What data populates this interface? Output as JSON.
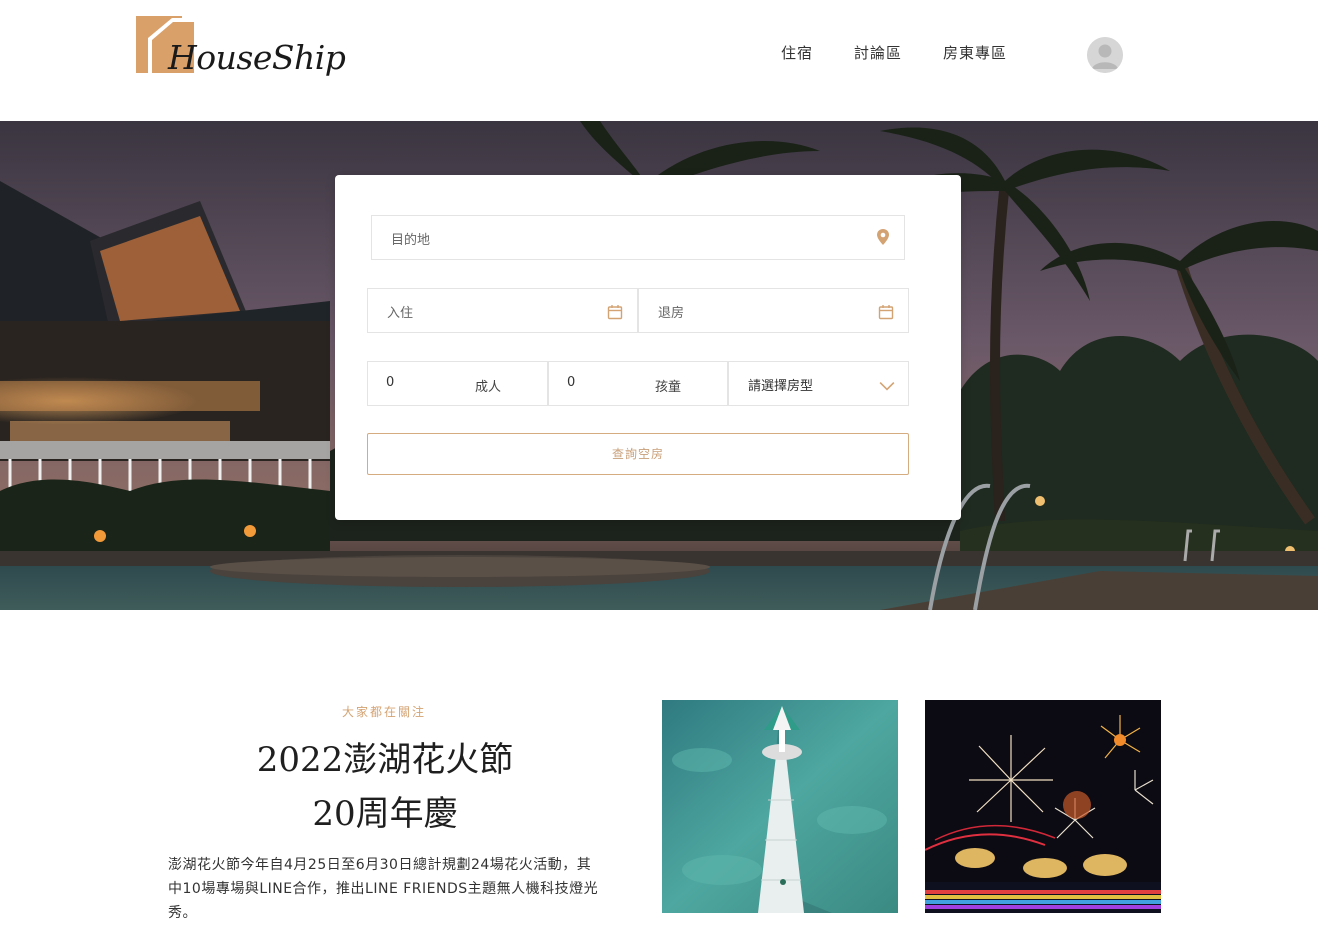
{
  "brand": {
    "name": "HouseShip"
  },
  "nav": {
    "items": [
      {
        "label": "住宿"
      },
      {
        "label": "討論區"
      },
      {
        "label": "房東專區"
      }
    ]
  },
  "search": {
    "destination_placeholder": "目的地",
    "checkin_placeholder": "入住",
    "checkout_placeholder": "退房",
    "adults_value": "0",
    "adults_label": "成人",
    "children_value": "0",
    "children_label": "孩童",
    "room_type_selected": "請選擇房型",
    "submit_label": "查詢空房"
  },
  "carousel": {
    "slide_count": 3,
    "active_index": 2
  },
  "feature": {
    "kicker": "大家都在關注",
    "title_line1": "2022澎湖花火節",
    "title_line2": "20周年慶",
    "body": "澎湖花火節今年自4月25日至6月30日總計規劃24場花火活動，其中10場專場與LINE合作，推出LINE FRIENDS主題無人機科技燈光秀。"
  },
  "colors": {
    "accent": "#d4a373",
    "logo_mark": "#d9a06a"
  },
  "icons": [
    "location-pin-icon",
    "calendar-icon",
    "chevron-down-icon",
    "user-avatar-icon"
  ]
}
